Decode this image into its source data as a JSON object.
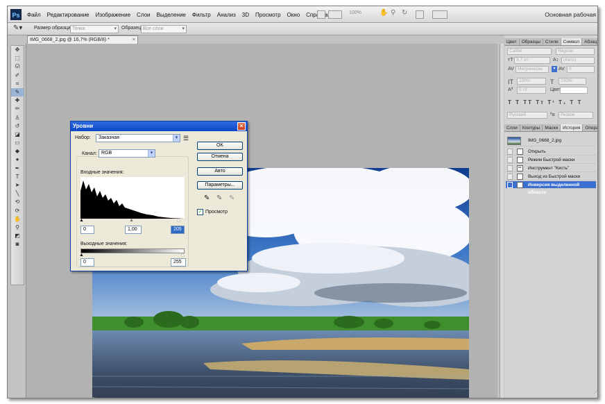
{
  "app": {
    "logo": "Ps",
    "menu": [
      "Файл",
      "Редактирование",
      "Изображение",
      "Слои",
      "Выделение",
      "Фильтр",
      "Анализ",
      "3D",
      "Просмотр",
      "Окно",
      "Справка"
    ],
    "zoom": "100%",
    "workspace": "Основная рабочая"
  },
  "options_bar": {
    "sample_size_label": "Размер образца:",
    "sample_size_value": "Точка",
    "sample_label": "Образец:",
    "sample_value": "Все слои"
  },
  "document": {
    "tab_title": "IMG_0668_2.jpg @ 16,7% (RGB/8) *",
    "close_glyph": "×"
  },
  "tools": [
    "move-tool",
    "marquee-tool",
    "lasso-tool",
    "quick-select-tool",
    "crop-tool",
    "eyedropper-tool",
    "healing-tool",
    "brush-tool",
    "stamp-tool",
    "history-brush-tool",
    "eraser-tool",
    "gradient-tool",
    "blur-tool",
    "dodge-tool",
    "pen-tool",
    "type-tool",
    "path-select-tool",
    "shape-tool",
    "3d-rotate-tool",
    "3d-orbit-tool",
    "hand-tool",
    "zoom-tool",
    "colors",
    "quick-mask"
  ],
  "levels_dialog": {
    "title": "Уровни",
    "preset_label": "Набор:",
    "preset_value": "Заказная",
    "channel_label": "Канал:",
    "channel_value": "RGB",
    "input_label": "Входные значения:",
    "input_black": "0",
    "input_mid": "1,00",
    "input_white": "205",
    "output_label": "Выходные значения:",
    "output_black": "0",
    "output_white": "255",
    "ok": "OK",
    "cancel": "Отмена",
    "auto": "Авто",
    "options": "Параметры...",
    "preview": "Просмотр",
    "preview_checked": true
  },
  "panels": {
    "top_tabs": [
      "Цвет",
      "Образцы",
      "Стили",
      "Символ",
      "Абзац"
    ],
    "top_active": "Символ",
    "character": {
      "font": "Calibri",
      "style": "Regular",
      "size": "3,7 пт",
      "leading": "(Авто)",
      "kerning": "Метрически",
      "tracking": "0",
      "vscale": "100%",
      "hscale": "100%",
      "baseline": "0 пт",
      "color_label": "Цвет:",
      "language": "Русский",
      "antialias": "Резкое"
    },
    "mid_tabs": [
      "Слои",
      "Контуры",
      "Маски",
      "История",
      "Операции"
    ],
    "mid_active": "История",
    "history": [
      {
        "label": "IMG_0668_2.jpg",
        "kind": "snapshot"
      },
      {
        "label": "Открыть",
        "kind": "step"
      },
      {
        "label": "Режим Быстрой маски",
        "kind": "step"
      },
      {
        "label": "Инструмент \"Кисть\"",
        "kind": "step"
      },
      {
        "label": "Выход из Быстрой маски",
        "kind": "step"
      },
      {
        "label": "Инверсия выделенной области",
        "kind": "step",
        "active": true
      }
    ]
  }
}
